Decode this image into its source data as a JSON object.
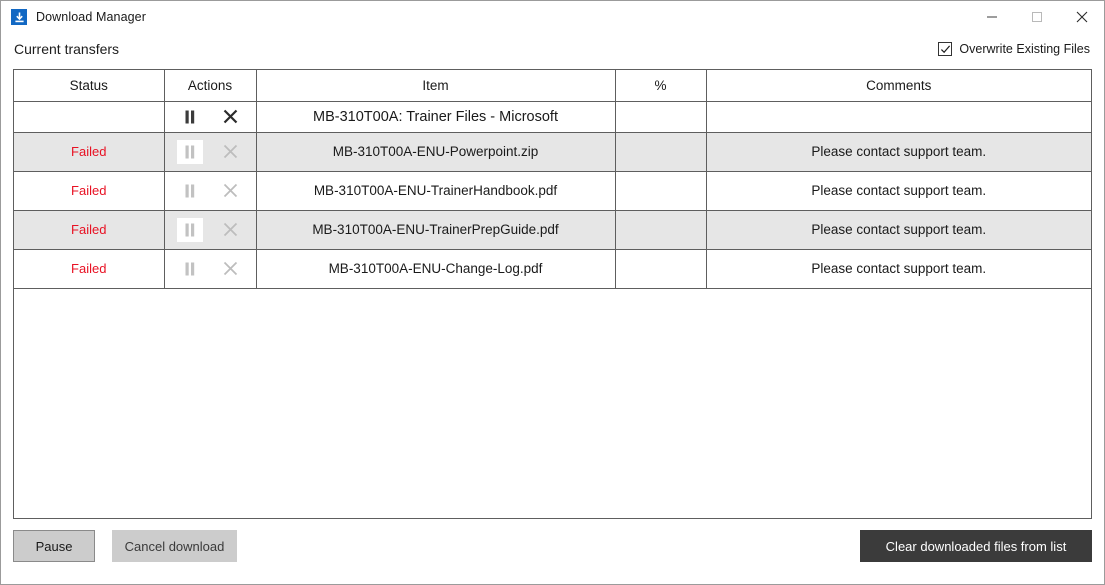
{
  "window": {
    "title": "Download Manager",
    "app_icon": "download-icon",
    "controls": {
      "minimize": "minimize-icon",
      "maximize": "maximize-icon",
      "close": "close-icon"
    }
  },
  "subheader": {
    "label": "Current transfers",
    "overwrite_label": "Overwrite Existing Files",
    "overwrite_checked": true
  },
  "table": {
    "columns": [
      "Status",
      "Actions",
      "Item",
      "%",
      "Comments"
    ],
    "rows": [
      {
        "type": "group",
        "status": "",
        "item": "MB-310T00A: Trainer Files - Microsoft",
        "percent": "",
        "comment": "",
        "actions_enabled": true,
        "shaded": false
      },
      {
        "type": "file",
        "status": "Failed",
        "item": "MB-310T00A-ENU-Powerpoint.zip",
        "percent": "",
        "comment": "Please contact support team.",
        "actions_enabled": false,
        "shaded": true
      },
      {
        "type": "file",
        "status": "Failed",
        "item": "MB-310T00A-ENU-TrainerHandbook.pdf",
        "percent": "",
        "comment": "Please contact support team.",
        "actions_enabled": false,
        "shaded": false
      },
      {
        "type": "file",
        "status": "Failed",
        "item": "MB-310T00A-ENU-TrainerPrepGuide.pdf",
        "percent": "",
        "comment": "Please contact support team.",
        "actions_enabled": false,
        "shaded": true
      },
      {
        "type": "file",
        "status": "Failed",
        "item": "MB-310T00A-ENU-Change-Log.pdf",
        "percent": "",
        "comment": "Please contact support team.",
        "actions_enabled": false,
        "shaded": false
      }
    ],
    "action_icons": {
      "pause": "pause-icon",
      "cancel": "close-icon"
    }
  },
  "footer": {
    "pause_label": "Pause",
    "cancel_label": "Cancel download",
    "clear_label": "Clear downloaded files from list"
  },
  "colors": {
    "accent": "#1268c3",
    "failed": "#e81123",
    "row_shaded": "#e6e6e6",
    "clear_button_bg": "#3b3b3b",
    "grid_line": "#5e5e5e"
  }
}
